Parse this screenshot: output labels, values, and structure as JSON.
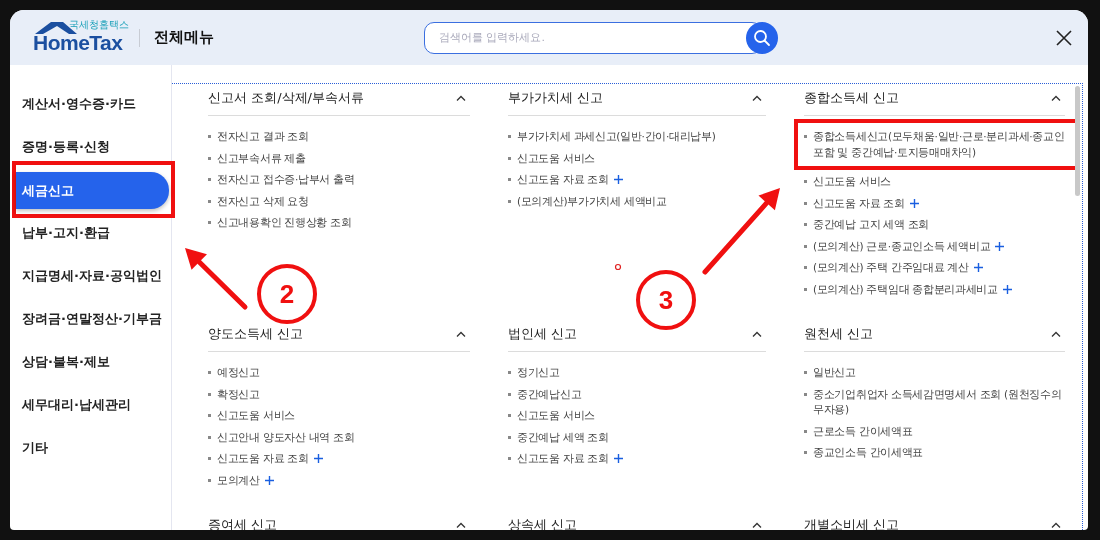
{
  "header": {
    "logo": {
      "tagline": "국세청홈택스",
      "name": "HomeTax"
    },
    "title": "전체메뉴",
    "search": {
      "placeholder": "검색어를 입력하세요."
    }
  },
  "sidebar": {
    "items": [
      {
        "label": "계산서·영수증·카드",
        "selected": false,
        "highlighted": false
      },
      {
        "label": "증명·등록·신청",
        "selected": false,
        "highlighted": false
      },
      {
        "label": "세금신고",
        "selected": true,
        "highlighted": true
      },
      {
        "label": "납부·고지·환급",
        "selected": false,
        "highlighted": false
      },
      {
        "label": "지급명세·자료·공익법인",
        "selected": false,
        "highlighted": false
      },
      {
        "label": "장려금·연말정산·기부금",
        "selected": false,
        "highlighted": false
      },
      {
        "label": "상담·불복·제보",
        "selected": false,
        "highlighted": false
      },
      {
        "label": "세무대리·납세관리",
        "selected": false,
        "highlighted": false
      },
      {
        "label": "기타",
        "selected": false,
        "highlighted": false
      }
    ]
  },
  "sections": [
    {
      "title": "신고서 조회/삭제/부속서류",
      "expanded": true,
      "items": [
        {
          "label": "전자신고 결과 조회",
          "plus": false,
          "highlighted": false
        },
        {
          "label": "신고부속서류 제출",
          "plus": false,
          "highlighted": false
        },
        {
          "label": "전자신고 접수증·납부서 출력",
          "plus": false,
          "highlighted": false
        },
        {
          "label": "전자신고 삭제 요청",
          "plus": false,
          "highlighted": false
        },
        {
          "label": "신고내용확인 진행상황 조회",
          "plus": false,
          "highlighted": false
        }
      ]
    },
    {
      "title": "부가가치세 신고",
      "expanded": true,
      "items": [
        {
          "label": "부가가치세 과세신고(일반·간이·대리납부)",
          "plus": false,
          "highlighted": false
        },
        {
          "label": "신고도움 서비스",
          "plus": false,
          "highlighted": false
        },
        {
          "label": "신고도움 자료 조회",
          "plus": true,
          "highlighted": false
        },
        {
          "label": "(모의계산)부가가치세 세액비교",
          "plus": false,
          "highlighted": false
        }
      ]
    },
    {
      "title": "종합소득세 신고",
      "expanded": true,
      "items": [
        {
          "label": "종합소득세신고(모두채움·일반·근로·분리과세·종교인포함 및 중간예납·토지등매매차익)",
          "plus": false,
          "highlighted": true
        },
        {
          "label": "신고도움 서비스",
          "plus": false,
          "highlighted": false
        },
        {
          "label": "신고도움 자료 조회",
          "plus": true,
          "highlighted": false
        },
        {
          "label": "중간예납 고지 세액 조회",
          "plus": false,
          "highlighted": false
        },
        {
          "label": "(모의계산) 근로·종교인소득 세액비교",
          "plus": true,
          "highlighted": false
        },
        {
          "label": "(모의계산) 주택 간주임대료 계산",
          "plus": true,
          "highlighted": false
        },
        {
          "label": "(모의계산) 주택임대 종합분리과세비교",
          "plus": true,
          "highlighted": false
        }
      ]
    },
    {
      "title": "양도소득세 신고",
      "expanded": true,
      "items": [
        {
          "label": "예정신고",
          "plus": false,
          "highlighted": false
        },
        {
          "label": "확정신고",
          "plus": false,
          "highlighted": false
        },
        {
          "label": "신고도움 서비스",
          "plus": false,
          "highlighted": false
        },
        {
          "label": "신고안내 양도자산 내역 조회",
          "plus": false,
          "highlighted": false
        },
        {
          "label": "신고도움 자료 조회",
          "plus": true,
          "highlighted": false
        },
        {
          "label": "모의계산",
          "plus": true,
          "highlighted": false
        }
      ]
    },
    {
      "title": "법인세 신고",
      "expanded": true,
      "items": [
        {
          "label": "정기신고",
          "plus": false,
          "highlighted": false
        },
        {
          "label": "중간예납신고",
          "plus": false,
          "highlighted": false
        },
        {
          "label": "신고도움 서비스",
          "plus": false,
          "highlighted": false
        },
        {
          "label": "중간예납 세액 조회",
          "plus": false,
          "highlighted": false
        },
        {
          "label": "신고도움 자료 조회",
          "plus": true,
          "highlighted": false
        }
      ]
    },
    {
      "title": "원천세 신고",
      "expanded": true,
      "items": [
        {
          "label": "일반신고",
          "plus": false,
          "highlighted": false
        },
        {
          "label": "중소기업취업자 소득세감면명세서 조회 (원천징수의무자용)",
          "plus": false,
          "highlighted": false
        },
        {
          "label": "근로소득 간이세액표",
          "plus": false,
          "highlighted": false
        },
        {
          "label": "종교인소득 간이세액표",
          "plus": false,
          "highlighted": false
        }
      ]
    },
    {
      "title": "증여세 신고",
      "expanded": true
    },
    {
      "title": "상속세 신고",
      "expanded": true
    },
    {
      "title": "개별소비세 신고",
      "expanded": true
    }
  ],
  "annotations": [
    {
      "kind": "arrow"
    },
    {
      "kind": "arrow"
    },
    {
      "kind": "callout",
      "label": "2"
    },
    {
      "kind": "callout",
      "label": "3"
    },
    {
      "kind": "dot"
    }
  ]
}
